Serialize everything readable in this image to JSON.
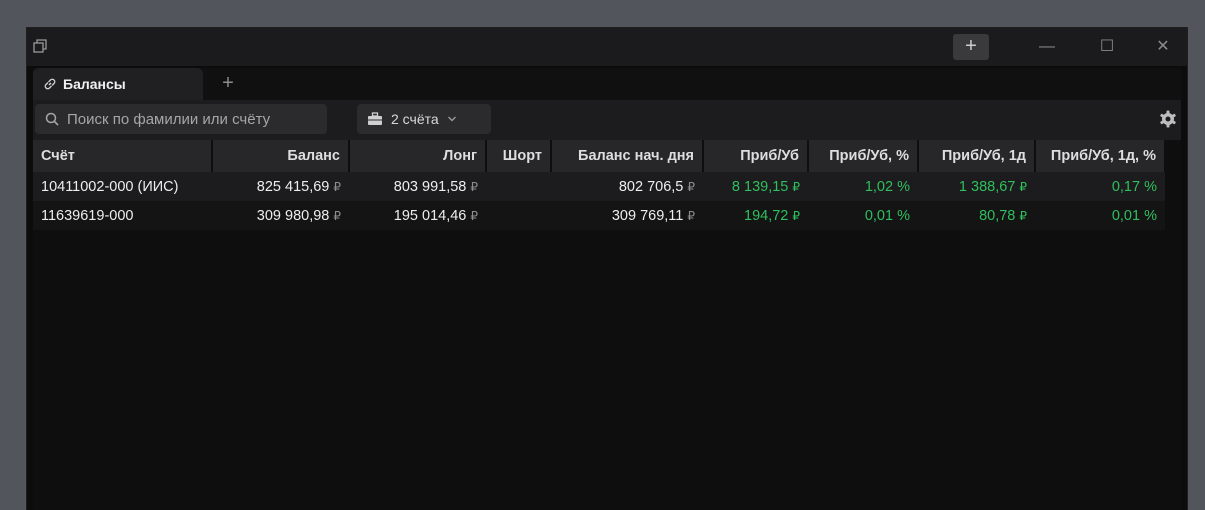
{
  "window": {
    "plus_label": "+",
    "minimize_label": "—",
    "maximize_label": "☐",
    "close_label": "✕"
  },
  "tabs": {
    "active_label": "Балансы",
    "add_label": "+"
  },
  "toolbar": {
    "search_placeholder": "Поиск по фамилии или счёту",
    "accounts_label": "2 счёта"
  },
  "table": {
    "columns": [
      "Счёт",
      "Баланс",
      "Лонг",
      "Шорт",
      "Баланс нач. дня",
      "Приб/Уб",
      "Приб/Уб, %",
      "Приб/Уб, 1д",
      "Приб/Уб, 1д, %"
    ],
    "currency_symbol": "₽",
    "rows": [
      {
        "account": "10411002-000 (ИИС)",
        "balance": "825 415,69",
        "long": "803 991,58",
        "short": "",
        "balance_start": "802 706,5",
        "pnl": "8 139,15",
        "pnl_pct": "1,02 %",
        "pnl_1d": "1 388,67",
        "pnl_1d_pct": "0,17 %"
      },
      {
        "account": "11639619-000",
        "balance": "309 980,98",
        "long": "195 014,46",
        "short": "",
        "balance_start": "309 769,11",
        "pnl": "194,72",
        "pnl_pct": "0,01 %",
        "pnl_1d": "80,78",
        "pnl_1d_pct": "0,01 %"
      }
    ]
  },
  "colors": {
    "positive": "#2fbf5e",
    "background": "#0e0e0e",
    "header": "#27272a"
  }
}
